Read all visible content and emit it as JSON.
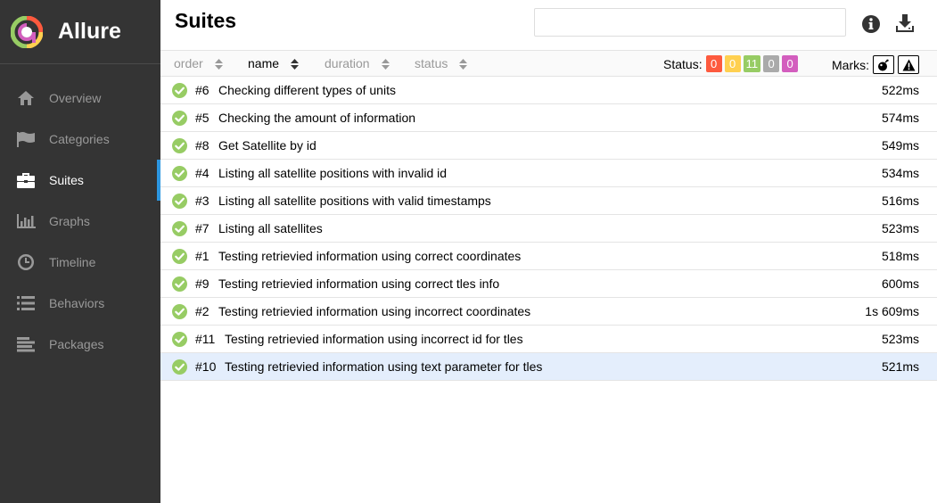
{
  "app": {
    "brand": "Allure"
  },
  "sidebar": {
    "items": [
      {
        "label": "Overview",
        "icon": "home-icon",
        "active": false
      },
      {
        "label": "Categories",
        "icon": "flag-icon",
        "active": false
      },
      {
        "label": "Suites",
        "icon": "briefcase-icon",
        "active": true
      },
      {
        "label": "Graphs",
        "icon": "bar-chart-icon",
        "active": false
      },
      {
        "label": "Timeline",
        "icon": "clock-icon",
        "active": false
      },
      {
        "label": "Behaviors",
        "icon": "list-icon",
        "active": false
      },
      {
        "label": "Packages",
        "icon": "align-left-icon",
        "active": false
      }
    ]
  },
  "header": {
    "title": "Suites",
    "search_value": ""
  },
  "sort": {
    "order": "order",
    "name": "name",
    "duration": "duration",
    "status": "status"
  },
  "status_filter": {
    "label": "Status:",
    "counts": [
      {
        "value": "0",
        "color": "#fd5a3e"
      },
      {
        "value": "0",
        "color": "#ffd050"
      },
      {
        "value": "11",
        "color": "#97cc64"
      },
      {
        "value": "0",
        "color": "#aaaaaa"
      },
      {
        "value": "0",
        "color": "#d35ebe"
      }
    ]
  },
  "marks": {
    "label": "Marks:"
  },
  "tests": [
    {
      "num": "#6",
      "name": "Checking different types of units",
      "duration": "522ms",
      "status": "passed",
      "selected": false
    },
    {
      "num": "#5",
      "name": "Checking the amount of information",
      "duration": "574ms",
      "status": "passed",
      "selected": false
    },
    {
      "num": "#8",
      "name": "Get Satellite by id",
      "duration": "549ms",
      "status": "passed",
      "selected": false
    },
    {
      "num": "#4",
      "name": "Listing all satellite positions with invalid id",
      "duration": "534ms",
      "status": "passed",
      "selected": false
    },
    {
      "num": "#3",
      "name": "Listing all satellite positions with valid timestamps",
      "duration": "516ms",
      "status": "passed",
      "selected": false
    },
    {
      "num": "#7",
      "name": "Listing all satellites",
      "duration": "523ms",
      "status": "passed",
      "selected": false
    },
    {
      "num": "#1",
      "name": "Testing retrievied information using correct coordinates",
      "duration": "518ms",
      "status": "passed",
      "selected": false
    },
    {
      "num": "#9",
      "name": "Testing retrievied information using correct tles info",
      "duration": "600ms",
      "status": "passed",
      "selected": false
    },
    {
      "num": "#2",
      "name": "Testing retrievied information using incorrect coordinates",
      "duration": "1s 609ms",
      "status": "passed",
      "selected": false
    },
    {
      "num": "#11",
      "name": "Testing retrievied information using incorrect id for tles",
      "duration": "523ms",
      "status": "passed",
      "selected": false
    },
    {
      "num": "#10",
      "name": "Testing retrievied information using text parameter for tles",
      "duration": "521ms",
      "status": "passed",
      "selected": true
    }
  ],
  "colors": {
    "passed": "#97cc64",
    "accent": "#2d96e0",
    "sidebar_bg": "#343434"
  }
}
